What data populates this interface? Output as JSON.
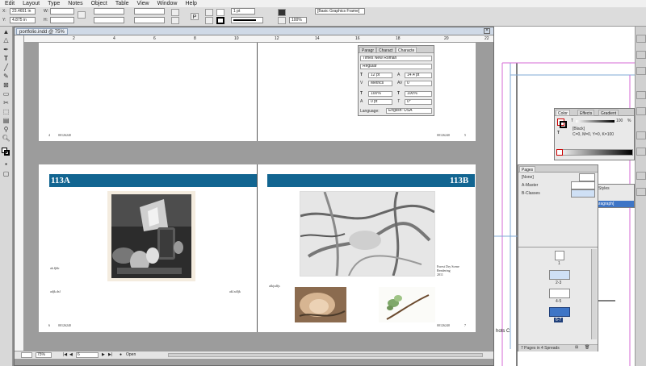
{
  "menu": [
    "Edit",
    "Layout",
    "Type",
    "Notes",
    "Object",
    "Table",
    "View",
    "Window",
    "Help"
  ],
  "control": {
    "x_label": "X:",
    "x_value": "23.4651 in",
    "y_label": "Y:",
    "y_value": "4.875 in",
    "w_label": "W:",
    "h_label": "H:",
    "stroke_weight": "1 pt",
    "zoom_pct": "100%",
    "object_style": "[Basic Graphics Frame]"
  },
  "document": {
    "tab_title": "portfolio.indd @ 75%",
    "ruler_ticks": [
      "2",
      "4",
      "6",
      "8",
      "10",
      "12",
      "14",
      "16",
      "18",
      "20",
      "22"
    ],
    "pages": {
      "p4_num": "4",
      "p4_code": "00126240",
      "p5_num": "5",
      "p5_code": "00126240",
      "p6_banner": "113A",
      "p7_banner": "113B",
      "p6_caption_left": "ak.fjklr",
      "p6_caption_left2": "adjk.dsf",
      "p6_caption_right": "akl.sdfjk",
      "p6_num": "6",
      "p6_code": "00126240",
      "p7_caption_left": "afkjsdfjs",
      "p7_caption_title": "Forest Dry Scene",
      "p7_caption_sub": "Rendering",
      "p7_caption_year": "2011",
      "p7_num": "7",
      "p7_code": "00126240"
    },
    "status": {
      "zoom": "75%",
      "page": "6",
      "mode": "Open"
    }
  },
  "character_panel": {
    "tabs": [
      "Paragr",
      "Charact",
      "Characte"
    ],
    "font": "Times New Roman",
    "style": "Regular",
    "size": "12 pt",
    "leading": "14.4 pt",
    "kerning": "Metrics",
    "tracking": "0",
    "vscale": "100%",
    "hscale": "100%",
    "baseline": "0 pt",
    "skew": "0°",
    "language_label": "Language:",
    "language": "English: USA"
  },
  "color_panel": {
    "tabs": [
      "Color",
      "Effects",
      "Gradient"
    ],
    "t_label": "T",
    "tint": "100",
    "tint_unit": "%",
    "swatch_name": "[Black]",
    "swatch_values": "C=0, M=0, Y=0, K=100"
  },
  "pages_panel": {
    "tab": "Pages",
    "masters": [
      "[None]",
      "A-Master",
      "B-Classes"
    ],
    "pages": [
      "1",
      "2-3",
      "4-5",
      "6-7"
    ],
    "footer": "7 Pages in 4 Spreads"
  },
  "styles_fragment": {
    "tab": "Styles",
    "item": "aragraph]"
  },
  "colors": {
    "banner": "#126591",
    "selection_blue": "#3e75c6"
  }
}
